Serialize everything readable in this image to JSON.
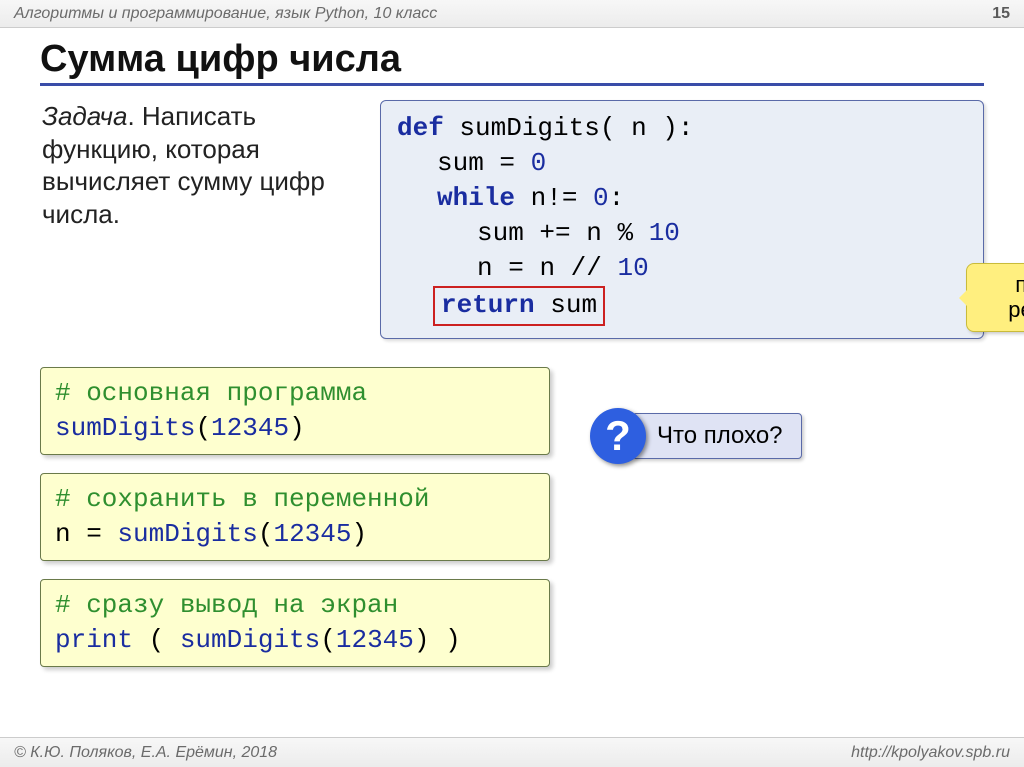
{
  "header": {
    "subject": "Алгоритмы и программирование, язык Python, 10 класс",
    "page": "15"
  },
  "title": "Сумма цифр числа",
  "task": {
    "label": "Задача",
    "body": ". Написать функцию, которая вычисляет сумму цифр числа."
  },
  "code": {
    "l1_def": "def",
    "l1_fn": "sumDigits",
    "l1_open": "(",
    "l1_arg": " n ",
    "l1_close": "):",
    "l2": "sum",
    "l2_eq": "=",
    "l2_zero": "0",
    "l3_while": "while",
    "l3_cond_a": "n!=",
    "l3_cond_b": "0",
    "l3_colon": ":",
    "l4_a": "sum",
    "l4_b": "+=",
    "l4_c": "n",
    "l4_d": "%",
    "l4_e": "10",
    "l5_a": "n",
    "l5_b": "=",
    "l5_c": "n",
    "l5_d": "//",
    "l5_e": "10",
    "l6_ret": "return",
    "l6_var": "sum"
  },
  "callout": "передача результата",
  "snips": {
    "s1_c": "# основная программа",
    "s1_fn": "sumDigits",
    "s1_open": "(",
    "s1_arg": "12345",
    "s1_close": ")",
    "s2_c": "# сохранить в переменной",
    "s2_a": "n = ",
    "s2_fn": "sumDigits",
    "s2_open": "(",
    "s2_arg": "12345",
    "s2_close": ")",
    "s3_c": "# сразу вывод на экран",
    "s3_print": "print",
    "s3_sp": " ( ",
    "s3_fn": "sumDigits",
    "s3_open": "(",
    "s3_arg": "12345",
    "s3_close": ") )"
  },
  "question": {
    "mark": "?",
    "text": "Что плохо?"
  },
  "footer": {
    "left": "© К.Ю. Поляков, Е.А. Ерёмин, 2018",
    "right": "http://kpolyakov.spb.ru"
  }
}
